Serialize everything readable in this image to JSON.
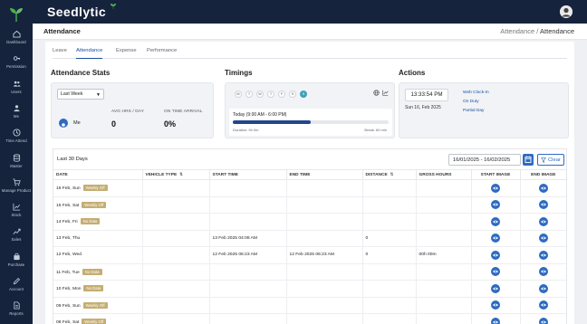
{
  "brand": "Seedlytic",
  "header": {
    "title": "Attendance",
    "breadcrumb_parent": "Attendance",
    "breadcrumb_sep": "/",
    "breadcrumb_current": "Attendance"
  },
  "sidebar": {
    "items": [
      {
        "label": "Dashboard",
        "icon": "home-icon"
      },
      {
        "label": "Permission",
        "icon": "key-icon"
      },
      {
        "label": "Users",
        "icon": "users-icon"
      },
      {
        "label": "Me",
        "icon": "user-icon"
      },
      {
        "label": "Time Attend",
        "icon": "clock-icon"
      },
      {
        "label": "Master",
        "icon": "database-icon"
      },
      {
        "label": "Manage Product",
        "icon": "cart-icon"
      },
      {
        "label": "Stock",
        "icon": "chart-line-icon"
      },
      {
        "label": "Sales",
        "icon": "sales-icon"
      },
      {
        "label": "Purchase",
        "icon": "bag-icon"
      },
      {
        "label": "Account",
        "icon": "pencil-icon"
      },
      {
        "label": "Reports",
        "icon": "document-icon"
      }
    ]
  },
  "tabs": [
    "Leave",
    "Attendance",
    "Expense",
    "Performance"
  ],
  "stats": {
    "title": "Attendance Stats",
    "period": "Last Week",
    "me_label": "Me",
    "avg_label": "AVG HRS / DAY",
    "avg_value": "0",
    "ontime_label": "ON TIME ARRIVAL",
    "ontime_value": "0%"
  },
  "timings": {
    "title": "Timings",
    "days": [
      "M",
      "T",
      "W",
      "T",
      "F",
      "S",
      "S"
    ],
    "active_day_index": 6,
    "today": "Today (9:00 AM - 6:00 PM)",
    "progress_fraction": 0.5,
    "duration": "Duration: 9h 0m",
    "break": "Break: 60 min"
  },
  "actions": {
    "title": "Actions",
    "clock": "13:33:54 PM",
    "date": "Sun 16, Feb 2025",
    "links": [
      "Web Clock-In",
      "On Duty",
      "Partial Day"
    ]
  },
  "table": {
    "caption": "Last 30 Days",
    "date_range": "16/01/2025 - 16/02/2025",
    "clear_label": "Clear",
    "columns": [
      "DATE",
      "VEHICLE TYPE",
      "START TIME",
      "END TIME",
      "DISTANCE",
      "GROSS HOURS",
      "START IMAGE",
      "END IMAGE"
    ],
    "rows": [
      {
        "date": "16 Feb, Sun",
        "badge": "Weekly Off",
        "vehicle": "",
        "start": "",
        "end": "",
        "distance": "",
        "gross": ""
      },
      {
        "date": "15 Feb, Sat",
        "badge": "Weekly Off",
        "vehicle": "",
        "start": "",
        "end": "",
        "distance": "",
        "gross": ""
      },
      {
        "date": "14 Feb, Fri",
        "badge": "No Data",
        "vehicle": "",
        "start": "",
        "end": "",
        "distance": "",
        "gross": ""
      },
      {
        "date": "13 Feb, Thu",
        "badge": "",
        "vehicle": "",
        "start": "13 Feb 2025 04:08 AM",
        "end": "",
        "distance": "0",
        "gross": ""
      },
      {
        "date": "12 Feb, Wed",
        "badge": "",
        "vehicle": "",
        "start": "12 Feb 2025 06:23 AM",
        "end": "12 Feb 2025 06:23 AM",
        "distance": "0",
        "gross": "00h 00m"
      },
      {
        "date": "11 Feb, Tue",
        "badge": "No Data",
        "vehicle": "",
        "start": "",
        "end": "",
        "distance": "",
        "gross": ""
      },
      {
        "date": "10 Feb, Mon",
        "badge": "No Data",
        "vehicle": "",
        "start": "",
        "end": "",
        "distance": "",
        "gross": ""
      },
      {
        "date": "09 Feb, Sun",
        "badge": "Weekly Off",
        "vehicle": "",
        "start": "",
        "end": "",
        "distance": "",
        "gross": ""
      },
      {
        "date": "08 Feb, Sat",
        "badge": "Weekly Off",
        "vehicle": "",
        "start": "",
        "end": "",
        "distance": "",
        "gross": ""
      }
    ]
  },
  "colors": {
    "sidebar": "#15233d",
    "accent": "#2e6bc2",
    "badge": "#c5ad72",
    "progress": "#23468c",
    "active_day": "#3aa3b8"
  }
}
